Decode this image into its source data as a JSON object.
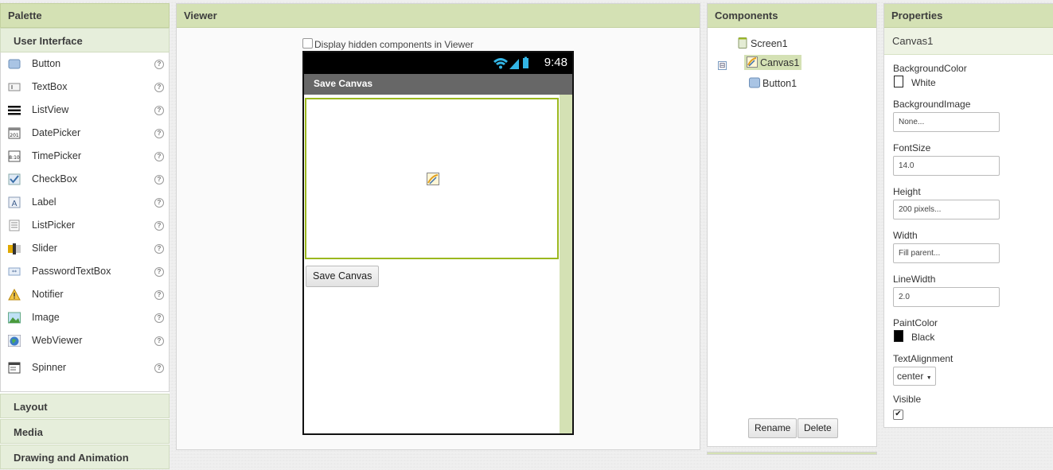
{
  "palette": {
    "title": "Palette",
    "categories": {
      "user_interface": "User Interface",
      "layout": "Layout",
      "media": "Media",
      "drawing": "Drawing and Animation"
    },
    "help_glyph": "?",
    "items": [
      {
        "label": "Button",
        "icon": "button-icon"
      },
      {
        "label": "TextBox",
        "icon": "textbox-icon"
      },
      {
        "label": "ListView",
        "icon": "listview-icon"
      },
      {
        "label": "DatePicker",
        "icon": "datepicker-icon"
      },
      {
        "label": "TimePicker",
        "icon": "timepicker-icon"
      },
      {
        "label": "CheckBox",
        "icon": "checkbox-icon"
      },
      {
        "label": "Label",
        "icon": "label-icon"
      },
      {
        "label": "ListPicker",
        "icon": "listpicker-icon"
      },
      {
        "label": "Slider",
        "icon": "slider-icon"
      },
      {
        "label": "PasswordTextBox",
        "icon": "passwordtextbox-icon"
      },
      {
        "label": "Notifier",
        "icon": "notifier-icon"
      },
      {
        "label": "Image",
        "icon": "image-icon"
      },
      {
        "label": "WebViewer",
        "icon": "webviewer-icon"
      },
      {
        "label": "Spinner",
        "icon": "spinner-icon"
      }
    ]
  },
  "viewer": {
    "title": "Viewer",
    "hidden_checkbox_label": "Display hidden components in Viewer",
    "phone": {
      "time": "9:48",
      "app_title": "Save Canvas",
      "button_label": "Save Canvas"
    }
  },
  "components": {
    "title": "Components",
    "toggle": "⊟",
    "screen": "Screen1",
    "children": [
      "Canvas1",
      "Button1"
    ],
    "rename_label": "Rename",
    "delete_label": "Delete"
  },
  "properties": {
    "title": "Properties",
    "component": "Canvas1",
    "background_color": {
      "label": "BackgroundColor",
      "value": "White",
      "color": "#ffffff"
    },
    "background_image": {
      "label": "BackgroundImage",
      "value": "None..."
    },
    "font_size": {
      "label": "FontSize",
      "value": "14.0"
    },
    "height": {
      "label": "Height",
      "value": "200 pixels..."
    },
    "width": {
      "label": "Width",
      "value": "Fill parent..."
    },
    "line_width": {
      "label": "LineWidth",
      "value": "2.0"
    },
    "paint_color": {
      "label": "PaintColor",
      "value": "Black",
      "color": "#000000"
    },
    "text_alignment": {
      "label": "TextAlignment",
      "value": "center"
    },
    "visible": {
      "label": "Visible",
      "checked": true
    }
  },
  "colors": {
    "accent": "#d4e1b4",
    "canvas_border": "#9bb81e"
  }
}
